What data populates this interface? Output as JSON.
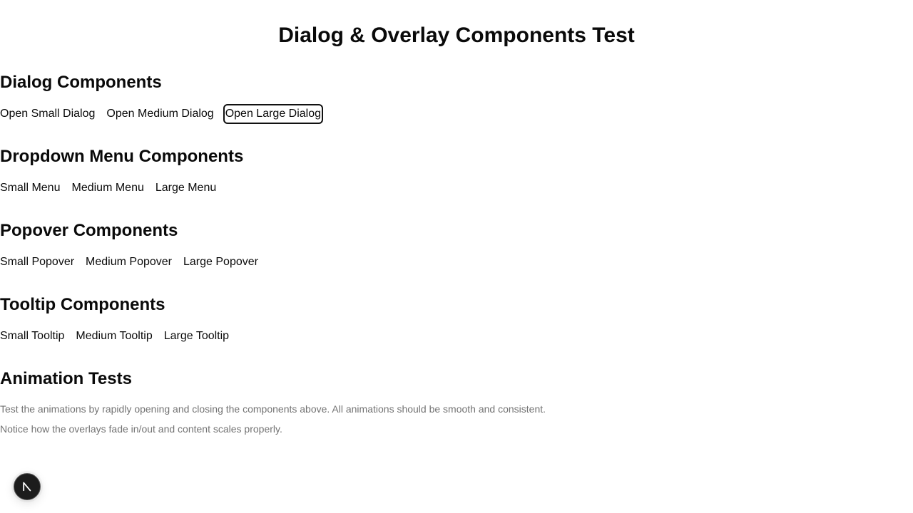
{
  "page": {
    "title": "Dialog & Overlay Components Test"
  },
  "sections": {
    "dialog": {
      "title": "Dialog Components",
      "buttons": [
        "Open Small Dialog",
        "Open Medium Dialog",
        "Open Large Dialog"
      ]
    },
    "dropdown": {
      "title": "Dropdown Menu Components",
      "buttons": [
        "Small Menu",
        "Medium Menu",
        "Large Menu"
      ]
    },
    "popover": {
      "title": "Popover Components",
      "buttons": [
        "Small Popover",
        "Medium Popover",
        "Large Popover"
      ]
    },
    "tooltip": {
      "title": "Tooltip Components",
      "buttons": [
        "Small Tooltip",
        "Medium Tooltip",
        "Large Tooltip"
      ]
    },
    "animation": {
      "title": "Animation Tests",
      "notes": [
        "Test the animations by rapidly opening and closing the components above. All animations should be smooth and consistent.",
        "Notice how the overlays fade in/out and content scales properly."
      ]
    }
  },
  "focused_button": "Open Large Dialog",
  "devtools_badge": {
    "icon": "nextjs-n-icon"
  },
  "colors": {
    "text": "#0a0a0a",
    "muted": "#737373",
    "badge_bg": "#1c1c1c"
  }
}
